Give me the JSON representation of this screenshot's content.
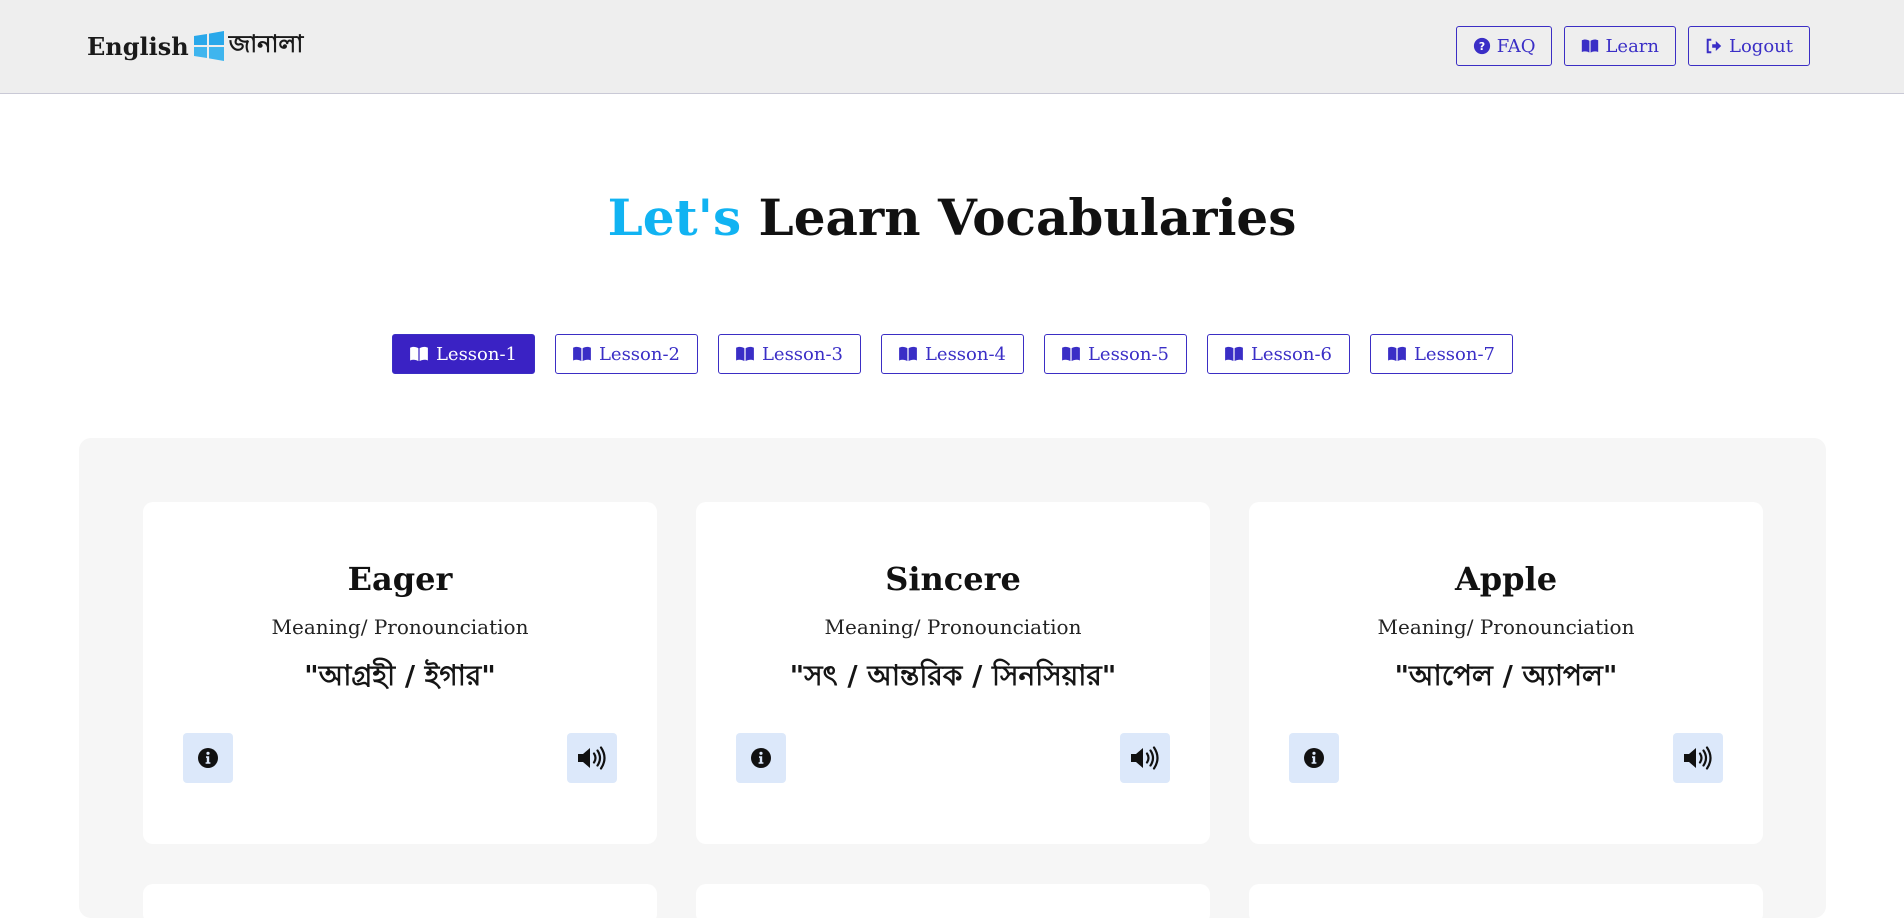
{
  "brand": {
    "name_en": "English",
    "name_bn": "জানালা"
  },
  "nav": {
    "faq_label": "FAQ",
    "learn_label": "Learn",
    "logout_label": "Logout"
  },
  "hero": {
    "accent": "Let's",
    "title": "Learn Vocabularies"
  },
  "lessons": [
    {
      "label": "Lesson-1",
      "active": true
    },
    {
      "label": "Lesson-2",
      "active": false
    },
    {
      "label": "Lesson-3",
      "active": false
    },
    {
      "label": "Lesson-4",
      "active": false
    },
    {
      "label": "Lesson-5",
      "active": false
    },
    {
      "label": "Lesson-6",
      "active": false
    },
    {
      "label": "Lesson-7",
      "active": false
    }
  ],
  "cards": [
    {
      "word": "Eager",
      "subtitle": "Meaning/ Pronounciation",
      "meaning": "\"আগ্রহী / ইগার\""
    },
    {
      "word": "Sincere",
      "subtitle": "Meaning/ Pronounciation",
      "meaning": "\"সৎ / আন্তরিক / সিনসিয়ার\""
    },
    {
      "word": "Apple",
      "subtitle": "Meaning/ Pronounciation",
      "meaning": "\"আপেল / অ্যাপল\""
    }
  ],
  "colors": {
    "primary": "#3a22c4",
    "accent": "#11b3f2",
    "header_bg": "#eeeeee",
    "icon_button_bg": "#dce8fa"
  },
  "icons": {
    "faq": "question-circle-icon",
    "learn": "book-open-icon",
    "logout": "sign-out-icon",
    "info": "info-circle-icon",
    "audio": "volume-high-icon"
  }
}
